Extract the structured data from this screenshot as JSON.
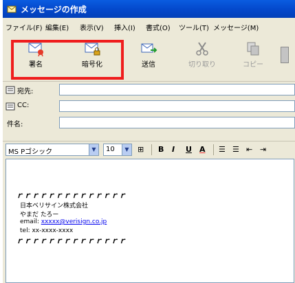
{
  "window": {
    "title": "メッセージの作成"
  },
  "menu": [
    "ファイル(F)",
    "編集(E)",
    "表示(V)",
    "挿入(I)",
    "書式(O)",
    "ツール(T)",
    "メッセージ(M)"
  ],
  "toolbar": {
    "sign_label": "署名",
    "encrypt_label": "暗号化",
    "send_label": "送信",
    "cut_label": "切り取り",
    "copy_label": "コピー"
  },
  "fields": {
    "to_label": "宛先:",
    "cc_label": "CC:",
    "subject_label": "件名:"
  },
  "format": {
    "font": "MS Pゴシック",
    "size": "10",
    "bold": "B",
    "italic": "I",
    "underline": "U",
    "color": "A"
  },
  "body": {
    "rule_top": "ｒｒｒｒｒｒｒｒｒｒｒｒｒｒ",
    "company": "日本ベリサイン株式会社",
    "name": "やまだ たろー",
    "email_label": "email:",
    "email": "xxxxx@verisign.co.jp",
    "tel": "tel: xx-xxxx-xxxx",
    "rule_bottom": "ｒｒｒｒｒｒｒｒｒｒｒｒｒｒ"
  }
}
